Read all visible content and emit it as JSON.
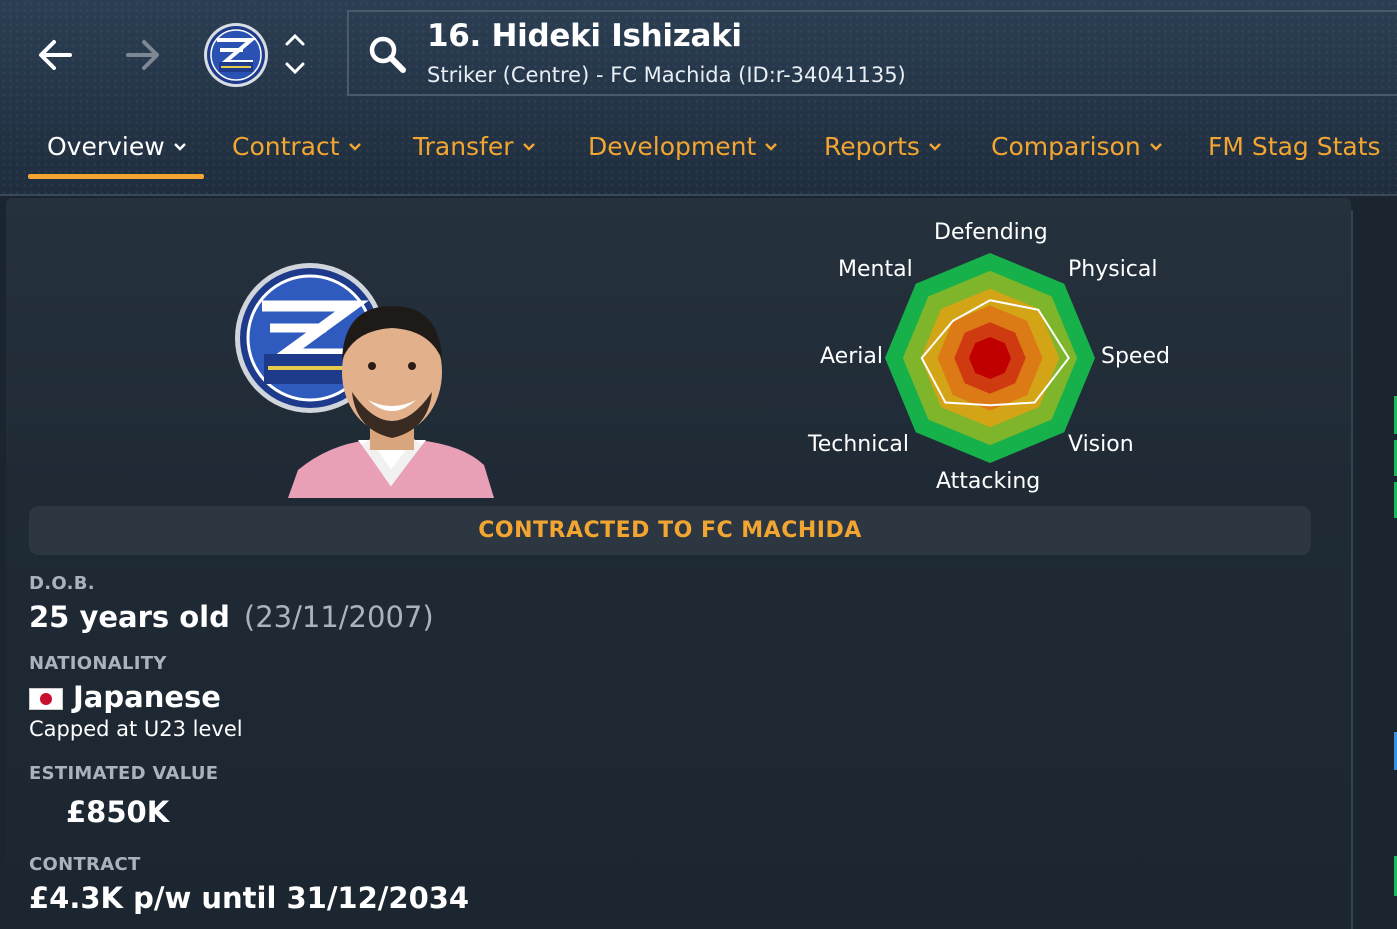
{
  "header": {
    "player_title": "16. Hideki Ishizaki",
    "player_subtitle": "Striker (Centre) - FC Machida (ID:r-34041135)",
    "back_icon": "arrow-left-icon",
    "forward_icon": "arrow-right-icon",
    "club_badge_icon": "fc-machida-zelvia-badge",
    "search_icon": "search-icon"
  },
  "tabs": [
    {
      "label": "Overview",
      "active": true,
      "has_dropdown": true
    },
    {
      "label": "Contract",
      "active": false,
      "has_dropdown": true
    },
    {
      "label": "Transfer",
      "active": false,
      "has_dropdown": true
    },
    {
      "label": "Development",
      "active": false,
      "has_dropdown": true
    },
    {
      "label": "Reports",
      "active": false,
      "has_dropdown": true
    },
    {
      "label": "Comparison",
      "active": false,
      "has_dropdown": true
    },
    {
      "label": "FM Stag Stats",
      "active": false,
      "has_dropdown": false
    }
  ],
  "radar": {
    "axes": [
      "Defending",
      "Physical",
      "Speed",
      "Vision",
      "Attacking",
      "Technical",
      "Aerial",
      "Mental"
    ],
    "player_values": [
      0.55,
      0.65,
      0.75,
      0.6,
      0.45,
      0.6,
      0.65,
      0.5
    ],
    "band_colors": [
      "#16b14a",
      "#7fb52a",
      "#d4a417",
      "#dc7a16",
      "#cf3a10",
      "#c00000"
    ]
  },
  "banner": "CONTRACTED TO FC MACHIDA",
  "details": {
    "dob_label": "D.O.B.",
    "age": "25 years old",
    "dob_date": "(23/11/2007)",
    "nationality_label": "NATIONALITY",
    "nationality": "Japanese",
    "caps": "Capped at U23 level",
    "value_label": "ESTIMATED VALUE",
    "value": "£850K",
    "contract_label": "CONTRACT",
    "contract": "£4.3K p/w until 31/12/2034"
  },
  "colors": {
    "accent": "#f2a531",
    "background": "#1b2530"
  }
}
